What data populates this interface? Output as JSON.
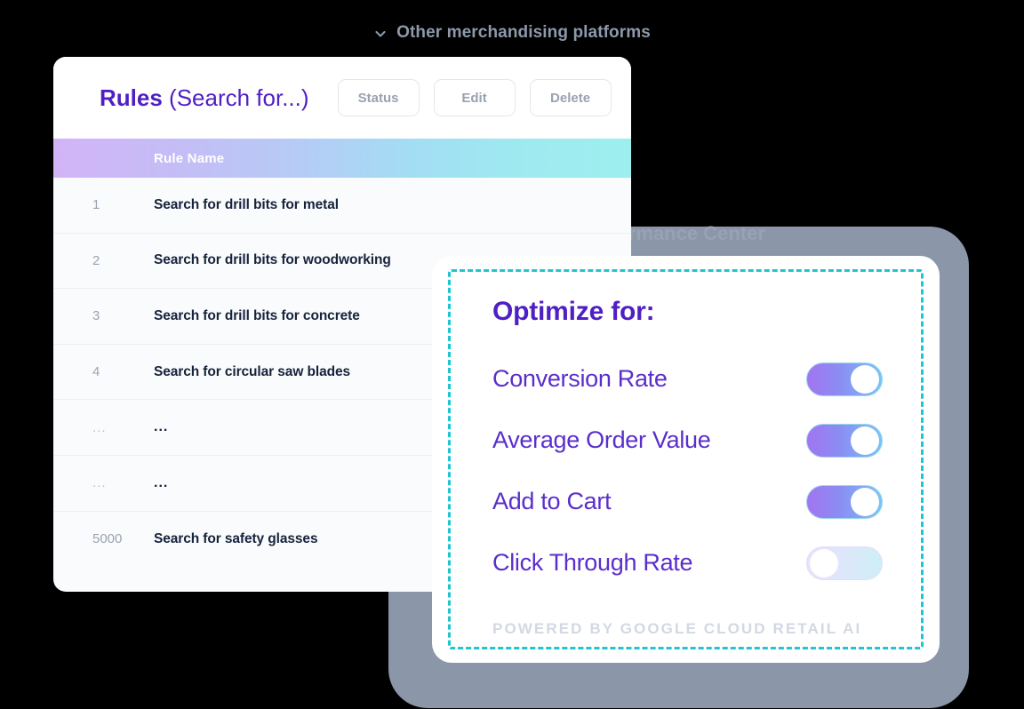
{
  "header": {
    "chevron_icon": "chevron-down-icon",
    "label": "Other merchandising platforms"
  },
  "backdrop": {
    "title": "Search Performance Center",
    "color": "#8b96a8"
  },
  "rules_card": {
    "title_bold": "Rules",
    "title_light": " (Search for...)",
    "buttons": [
      {
        "label": "Status",
        "name": "status-button"
      },
      {
        "label": "Edit",
        "name": "edit-button"
      },
      {
        "label": "Delete",
        "name": "delete-button"
      }
    ],
    "columns": [
      "",
      "Rule Name"
    ],
    "rows": [
      {
        "num": "1",
        "name": "Search for drill bits for metal"
      },
      {
        "num": "2",
        "name": "Search for drill bits for woodworking"
      },
      {
        "num": "3",
        "name": "Search for drill bits for concrete"
      },
      {
        "num": "4",
        "name": "Search for circular saw blades"
      },
      {
        "num": "...",
        "name": "..."
      },
      {
        "num": "...",
        "name": "..."
      },
      {
        "num": "5000",
        "name": "Search for safety glasses"
      }
    ],
    "header_gradient_from": "#d2b4f7",
    "header_gradient_to": "#9defef"
  },
  "optimize_card": {
    "title": "Optimize for:",
    "toggles": [
      {
        "label": "Conversion Rate",
        "state": "on"
      },
      {
        "label": "Average Order Value",
        "state": "on"
      },
      {
        "label": "Add to Cart",
        "state": "on"
      },
      {
        "label": "Click Through Rate",
        "state": "off"
      }
    ],
    "footer": "POWERED BY GOOGLE CLOUD RETAIL AI",
    "accent_purple": "#4f1fc4",
    "dash_color": "#1fc5d0"
  }
}
